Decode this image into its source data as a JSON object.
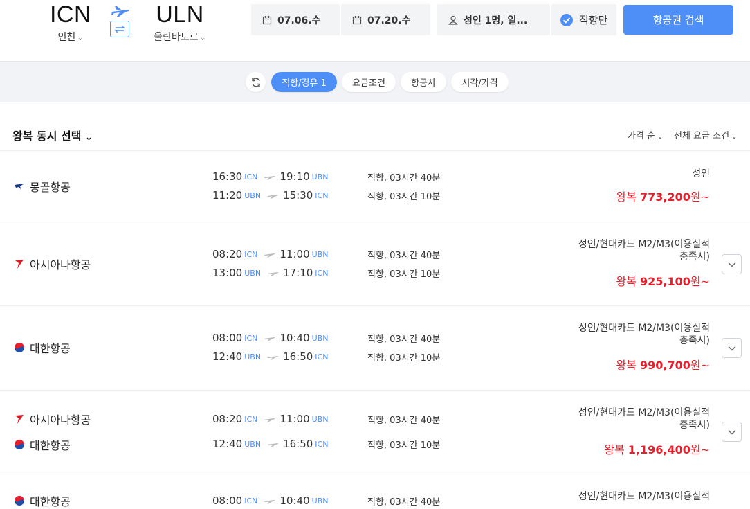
{
  "header": {
    "origin": {
      "code": "ICN",
      "city": "인천"
    },
    "destination": {
      "code": "ULN",
      "city": "울란바토르"
    },
    "depart_date": "07.06.수",
    "return_date": "07.20.수",
    "passengers": "성인 1명, 일...",
    "direct_only": "직항만",
    "search_label": "항공권 검색"
  },
  "filters": {
    "stops": "직항/경유 1",
    "fare": "요금조건",
    "airline": "항공사",
    "time_price": "시각/가격"
  },
  "list": {
    "title": "왕복 동시 선택",
    "sort": "가격 순",
    "fare_condition": "전체 요금 조건"
  },
  "results": [
    {
      "airlines": [
        "몽골항공"
      ],
      "out": {
        "dep": "16:30",
        "dep_ap": "ICN",
        "arr": "19:10",
        "arr_ap": "UBN",
        "info": "직항, 03시간 40분"
      },
      "ret": {
        "dep": "11:20",
        "dep_ap": "UBN",
        "arr": "15:30",
        "arr_ap": "ICN",
        "info": "직항, 03시간 10분"
      },
      "fare_line1": "성인",
      "fare_line2": "",
      "price_prefix": "왕복",
      "price": "773,200",
      "price_suffix": "원~"
    },
    {
      "airlines": [
        "아시아나항공"
      ],
      "out": {
        "dep": "08:20",
        "dep_ap": "ICN",
        "arr": "11:00",
        "arr_ap": "UBN",
        "info": "직항, 03시간 40분"
      },
      "ret": {
        "dep": "13:00",
        "dep_ap": "UBN",
        "arr": "17:10",
        "arr_ap": "ICN",
        "info": "직항, 03시간 10분"
      },
      "fare_line1": "성인/현대카드 M2/M3(이용실적",
      "fare_line2": "충족시)",
      "price_prefix": "왕복",
      "price": "925,100",
      "price_suffix": "원~"
    },
    {
      "airlines": [
        "대한항공"
      ],
      "out": {
        "dep": "08:00",
        "dep_ap": "ICN",
        "arr": "10:40",
        "arr_ap": "UBN",
        "info": "직항, 03시간 40분"
      },
      "ret": {
        "dep": "12:40",
        "dep_ap": "UBN",
        "arr": "16:50",
        "arr_ap": "ICN",
        "info": "직항, 03시간 10분"
      },
      "fare_line1": "성인/현대카드 M2/M3(이용실적",
      "fare_line2": "충족시)",
      "price_prefix": "왕복",
      "price": "990,700",
      "price_suffix": "원~"
    },
    {
      "airlines": [
        "아시아나항공",
        "대한항공"
      ],
      "out": {
        "dep": "08:20",
        "dep_ap": "ICN",
        "arr": "11:00",
        "arr_ap": "UBN",
        "info": "직항, 03시간 40분"
      },
      "ret": {
        "dep": "12:40",
        "dep_ap": "UBN",
        "arr": "16:50",
        "arr_ap": "ICN",
        "info": "직항, 03시간 10분"
      },
      "fare_line1": "성인/현대카드 M2/M3(이용실적",
      "fare_line2": "충족시)",
      "price_prefix": "왕복",
      "price": "1,196,400",
      "price_suffix": "원~"
    },
    {
      "airlines": [
        "대한항공"
      ],
      "out": {
        "dep": "08:00",
        "dep_ap": "ICN",
        "arr": "10:40",
        "arr_ap": "UBN",
        "info": "직항, 03시간 40분"
      },
      "fare_line1": "성인/현대카드 M2/M3(이용실적"
    }
  ],
  "colors": {
    "accent": "#4e8ef7",
    "price": "#e5202c",
    "filter_bg": "#f1f3f7"
  }
}
